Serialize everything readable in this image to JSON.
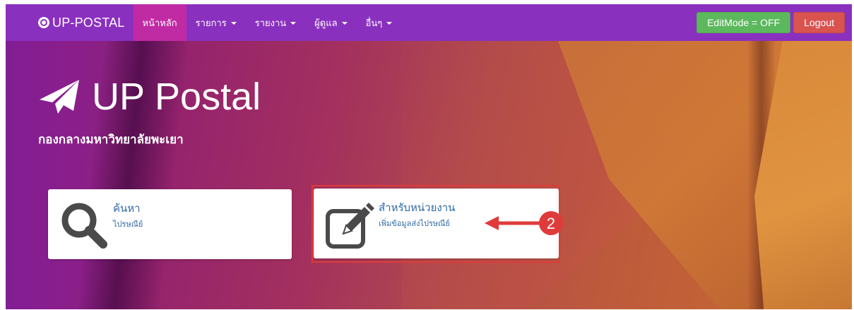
{
  "navbar": {
    "brand": "UP-POSTAL",
    "items": [
      {
        "label": "หน้าหลัก",
        "active": true,
        "dropdown": false
      },
      {
        "label": "รายการ",
        "active": false,
        "dropdown": true
      },
      {
        "label": "รายงาน",
        "active": false,
        "dropdown": true
      },
      {
        "label": "ผู้ดูแล",
        "active": false,
        "dropdown": true
      },
      {
        "label": "อื่นๆ",
        "active": false,
        "dropdown": true
      }
    ],
    "edit_mode_label": "EditMode = OFF",
    "logout_label": "Logout"
  },
  "hero": {
    "title": "UP Postal",
    "subtitle": "กองกลางมหาวิทยาลัยพะเยา",
    "icon": "paper-plane-icon"
  },
  "cards": [
    {
      "title": "ค้นหา",
      "subtitle": "ไปรษณีย์",
      "icon": "search-icon"
    },
    {
      "title": "สำหรับหน่วยงาน",
      "subtitle": "เพิ่มข้อมูลส่งไปรษณีย์",
      "icon": "edit-icon"
    }
  ],
  "annotation": {
    "number": "2",
    "color": "#e03b3b"
  },
  "colors": {
    "navbar": "#8a30bf",
    "nav_active": "#c02aa3",
    "edit_button": "#5cb85c",
    "logout_button": "#d9534f",
    "card_text": "#2f6aa3"
  }
}
